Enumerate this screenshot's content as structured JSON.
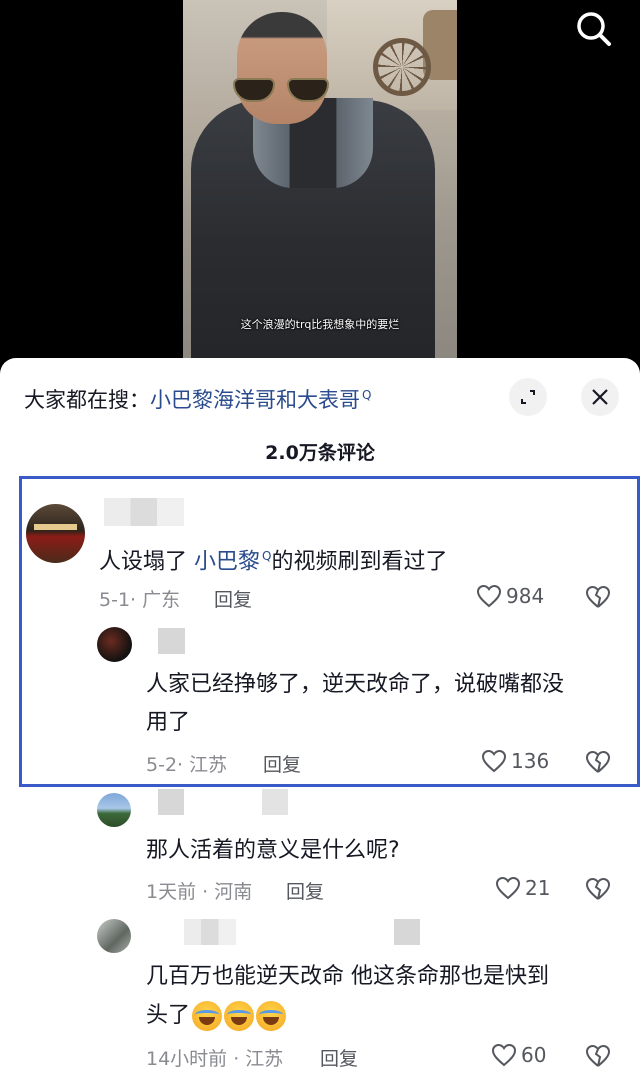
{
  "video": {
    "subtitle": "这个浪漫的trq比我想象中的要烂"
  },
  "sheet": {
    "search_prefix": "大家都在搜：",
    "search_keyword": "小巴黎海洋哥和大表哥",
    "comment_count": "2.0万条评论"
  },
  "comments": [
    {
      "text_before": "人设塌了 ",
      "keyword": "小巴黎",
      "text_after": "的视频刷到看过了",
      "meta": "5-1· 广东",
      "reply_label": "回复",
      "likes": "984"
    },
    {
      "line1": "人家已经挣够了，逆天改命了，说破嘴都没",
      "line2": "用了",
      "meta": "5-2· 江苏",
      "reply_label": "回复",
      "likes": "136"
    },
    {
      "text": "那人活着的意义是什么呢?",
      "meta": "1天前 · 河南",
      "reply_label": "回复",
      "likes": "21"
    },
    {
      "line1": "几百万也能逆天改命    他这条命那也是快到",
      "line2": "头了",
      "meta": "14小时前 · 江苏",
      "reply_label": "回复",
      "likes": "60"
    }
  ],
  "icons": {
    "search": "search-icon",
    "expand": "expand-icon",
    "close": "close-icon",
    "like": "heart-icon",
    "dislike": "broken-heart-icon",
    "emoji": "laughing-crying-emoji"
  },
  "colors": {
    "keyword": "#2a4b8d",
    "highlight_border": "#3a5bc7",
    "meta": "#8a8b91"
  }
}
